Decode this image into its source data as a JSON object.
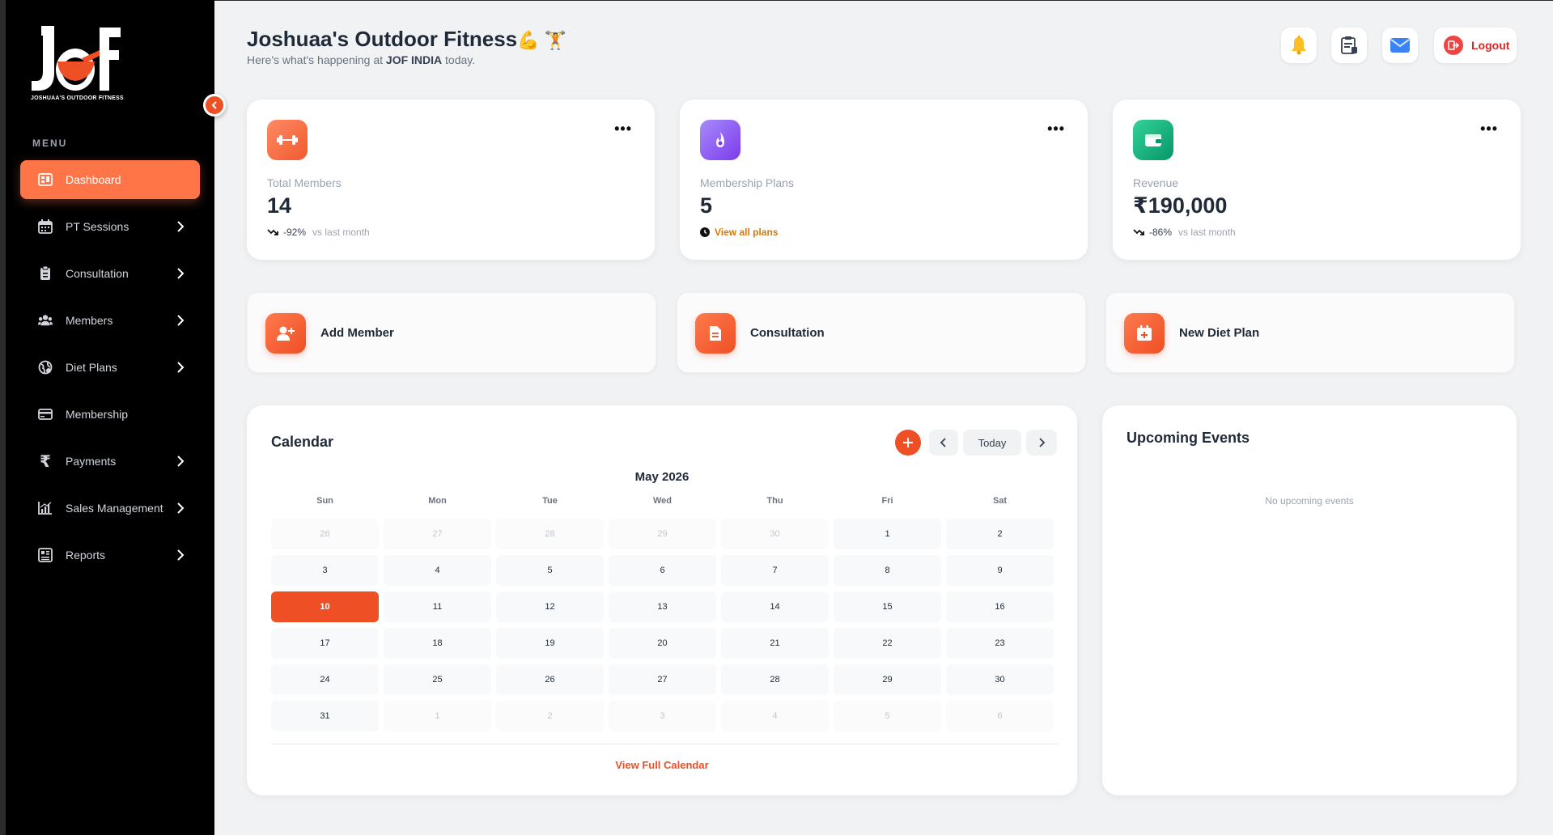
{
  "brand": {
    "logo_text": "JOF",
    "logo_caption": "JOSHUAA'S OUTDOOR FITNESS"
  },
  "sidebar": {
    "menu_title": "MENU",
    "items": [
      {
        "label": "Dashboard",
        "icon": "dashboard-icon",
        "active": true
      },
      {
        "label": "PT Sessions",
        "icon": "calendar-icon",
        "has_submenu": true
      },
      {
        "label": "Consultation",
        "icon": "clipboard-icon",
        "has_submenu": true
      },
      {
        "label": "Members",
        "icon": "users-icon",
        "has_submenu": true
      },
      {
        "label": "Diet Plans",
        "icon": "globe-icon",
        "has_submenu": true
      },
      {
        "label": "Membership",
        "icon": "card-icon",
        "has_submenu": false
      },
      {
        "label": "Payments",
        "icon": "rupee-icon",
        "has_submenu": true
      },
      {
        "label": "Sales Management",
        "icon": "bar-chart-icon",
        "has_submenu": true
      },
      {
        "label": "Reports",
        "icon": "report-icon",
        "has_submenu": true
      }
    ]
  },
  "header": {
    "title": "Joshuaa's Outdoor Fitness",
    "title_emoji": "💪 🏋",
    "subtitle_prefix": "Here's what's happening at",
    "subtitle_org": "JOF INDIA",
    "subtitle_suffix": "today.",
    "logout_label": "Logout"
  },
  "stats": [
    {
      "label": "Total Members",
      "value": "14",
      "trend": "-92%",
      "trend_note": "vs last month",
      "icon": "dumbbell-icon",
      "color": "#f26b45"
    },
    {
      "label": "Membership Plans",
      "value": "5",
      "link": "View all plans",
      "icon": "fire-icon",
      "color": "#8b5cf6"
    },
    {
      "label": "Revenue",
      "value": "₹190,000",
      "trend": "-86%",
      "trend_note": "vs last month",
      "icon": "wallet-icon",
      "color": "#10b981"
    }
  ],
  "quick_actions": [
    {
      "label": "Add Member",
      "icon": "user-plus-icon"
    },
    {
      "label": "Consultation",
      "icon": "document-icon"
    },
    {
      "label": "New Diet Plan",
      "icon": "calendar-plus-icon"
    }
  ],
  "calendar": {
    "title": "Calendar",
    "today_label": "Today",
    "month_label": "May 2026",
    "weekdays": [
      "Sun",
      "Mon",
      "Tue",
      "Wed",
      "Thu",
      "Fri",
      "Sat"
    ],
    "days": [
      {
        "d": "26",
        "m": true
      },
      {
        "d": "27",
        "m": true
      },
      {
        "d": "28",
        "m": true
      },
      {
        "d": "29",
        "m": true
      },
      {
        "d": "30",
        "m": true
      },
      {
        "d": "1"
      },
      {
        "d": "2"
      },
      {
        "d": "3"
      },
      {
        "d": "4"
      },
      {
        "d": "5"
      },
      {
        "d": "6"
      },
      {
        "d": "7"
      },
      {
        "d": "8"
      },
      {
        "d": "9"
      },
      {
        "d": "10",
        "today": true
      },
      {
        "d": "11"
      },
      {
        "d": "12"
      },
      {
        "d": "13"
      },
      {
        "d": "14"
      },
      {
        "d": "15"
      },
      {
        "d": "16"
      },
      {
        "d": "17"
      },
      {
        "d": "18"
      },
      {
        "d": "19"
      },
      {
        "d": "20"
      },
      {
        "d": "21"
      },
      {
        "d": "22"
      },
      {
        "d": "23"
      },
      {
        "d": "24"
      },
      {
        "d": "25"
      },
      {
        "d": "26"
      },
      {
        "d": "27"
      },
      {
        "d": "28"
      },
      {
        "d": "29"
      },
      {
        "d": "30"
      },
      {
        "d": "31"
      },
      {
        "d": "1",
        "m": true
      },
      {
        "d": "2",
        "m": true
      },
      {
        "d": "3",
        "m": true
      },
      {
        "d": "4",
        "m": true
      },
      {
        "d": "5",
        "m": true
      },
      {
        "d": "6",
        "m": true
      }
    ],
    "view_full_label": "View Full Calendar"
  },
  "events": {
    "title": "Upcoming Events",
    "empty_text": "No upcoming events"
  },
  "colors": {
    "accent": "#ee4f24",
    "sidebar_bg": "#000000",
    "page_bg": "#f1f2f4"
  }
}
